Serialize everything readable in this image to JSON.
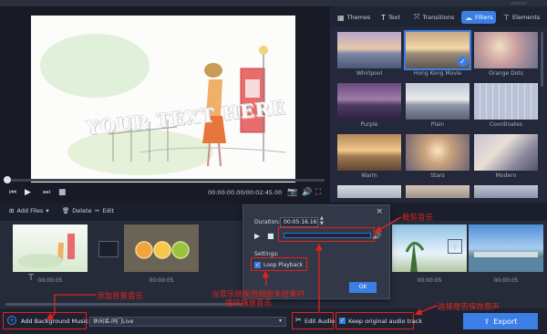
{
  "player": {
    "watermark": "YOUR TEXT HERE",
    "time": "00:00:00.00/00:02:45.00"
  },
  "tabs": [
    {
      "label": "Themes",
      "icon": "grid-icon"
    },
    {
      "label": "Text",
      "icon": "text-icon"
    },
    {
      "label": "Transitions",
      "icon": "transitions-icon"
    },
    {
      "label": "Filters",
      "icon": "filters-icon",
      "active": true
    },
    {
      "label": "Elements",
      "icon": "elements-icon"
    }
  ],
  "filters": [
    {
      "label": "Whirlpool"
    },
    {
      "label": "Hong Kong Movie",
      "selected": true
    },
    {
      "label": "Orange Dots"
    },
    {
      "label": "Purple"
    },
    {
      "label": "Plain"
    },
    {
      "label": "Coordinates"
    },
    {
      "label": "Warm"
    },
    {
      "label": "Stars"
    },
    {
      "label": "Modern"
    }
  ],
  "toolbar": {
    "add_files": "Add Files",
    "delete": "Delete",
    "edit": "Edit"
  },
  "clips": [
    {
      "time": "00:00:05"
    },
    {
      "time": "00:00:05"
    },
    {
      "time": "00:00:05"
    },
    {
      "time": "00:00:05"
    }
  ],
  "dialog": {
    "duration_label": "Duration:",
    "duration_value": "00:05:16.16",
    "settings_label": "Settings:",
    "loop_label": "Loop Playback",
    "ok_label": "OK"
  },
  "bottom": {
    "add_music_label": "Add Background Music:",
    "music_value": "休闲谣-同门Live",
    "edit_audio_label": "Edit Audio",
    "keep_audio_label": "Keep original audio track",
    "export_label": "Export"
  },
  "annotations": {
    "cut_music": "裁剪音乐",
    "add_bgm": "添加背景音乐",
    "loop_note_line1": "当音乐结束而相册未结束时",
    "loop_note_line2": "循环播放音乐",
    "keep_original": "选择是否保存原声"
  },
  "colors": {
    "accent": "#3b7ee6",
    "annotation": "#e0241b",
    "background": "#1e2230"
  }
}
